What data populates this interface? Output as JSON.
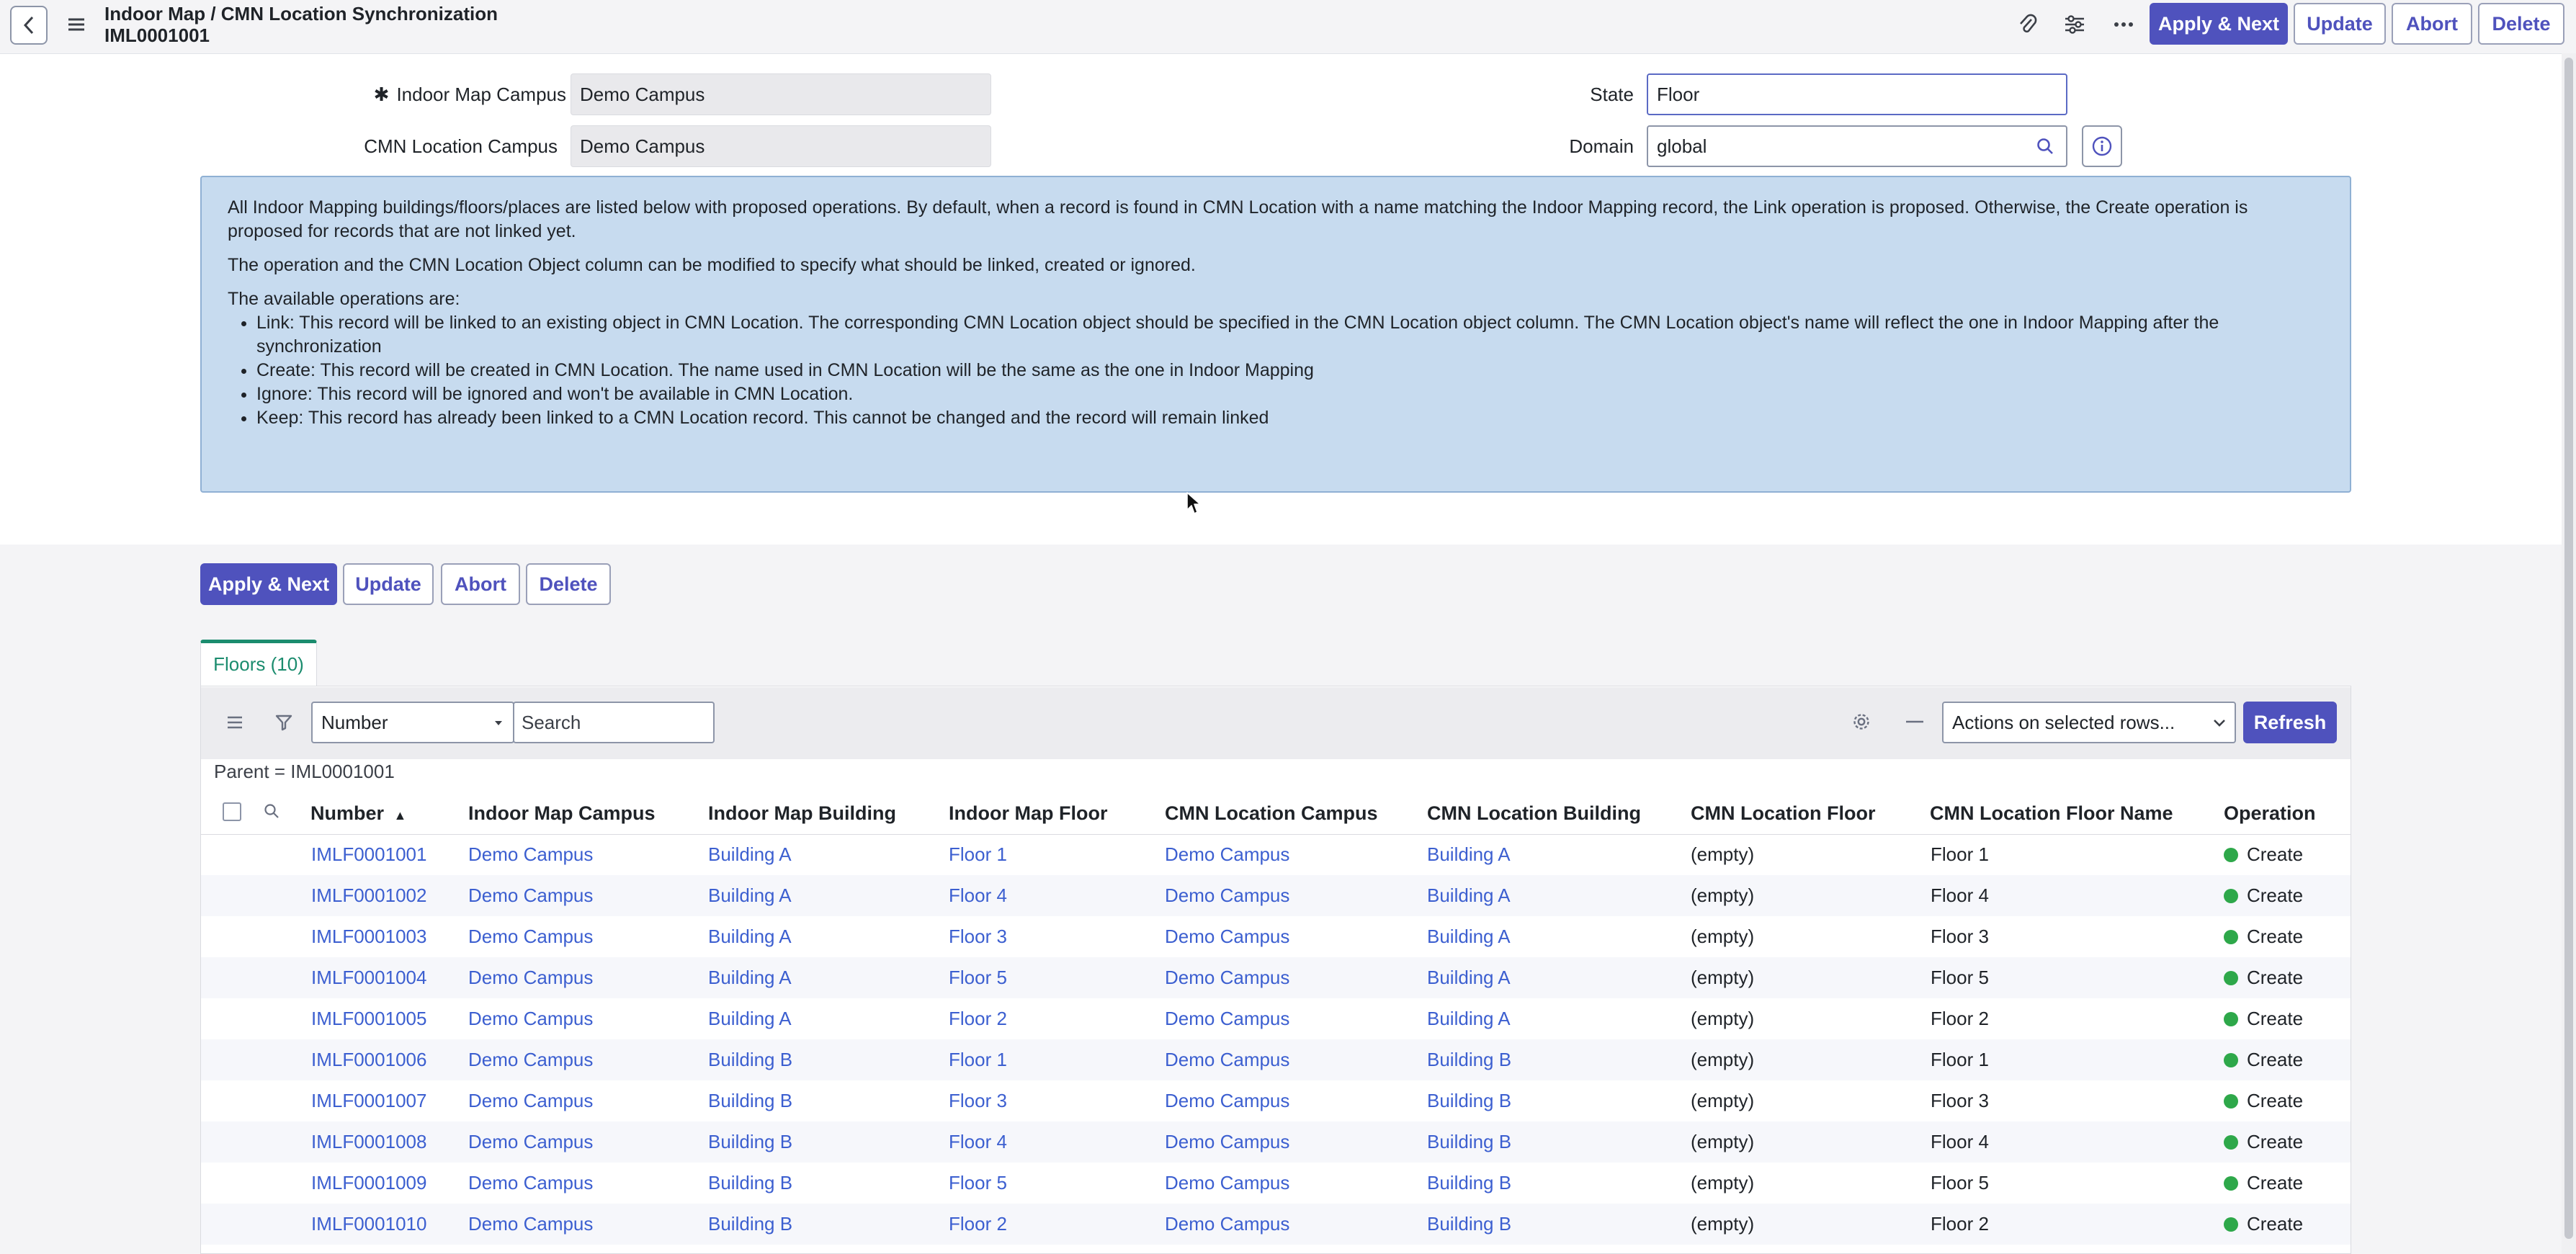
{
  "header": {
    "title": "Indoor Map / CMN Location Synchronization",
    "record_number": "IML0001001",
    "buttons": {
      "apply_next": "Apply & Next",
      "update": "Update",
      "abort": "Abort",
      "delete": "Delete"
    }
  },
  "form": {
    "indoor_map_campus_label": "Indoor Map Campus",
    "indoor_map_campus_value": "Demo Campus",
    "cmn_location_campus_label": "CMN Location Campus",
    "cmn_location_campus_value": "Demo Campus",
    "state_label": "State",
    "state_value": "Floor",
    "domain_label": "Domain",
    "domain_value": "global",
    "required_mark": "✱"
  },
  "info": {
    "p1": "All Indoor Mapping buildings/floors/places are listed below with proposed operations. By default, when a record is found in CMN Location with a name matching the Indoor Mapping record, the Link operation is proposed. Otherwise, the Create operation is proposed for records that are not linked yet.",
    "p2": "The operation and the CMN Location Object column can be modified to specify what should be linked, created or ignored.",
    "p3": "The available operations are:",
    "items": [
      "Link: This record will be linked to an existing object in CMN Location. The corresponding CMN Location object should be specified in the CMN Location object column. The CMN Location object's name will reflect the one in Indoor Mapping after the synchronization",
      "Create: This record will be created in CMN Location. The name used in CMN Location will be the same as the one in Indoor Mapping",
      "Ignore: This record will be ignored and won't be available in CMN Location.",
      "Keep: This record has already been linked to a CMN Location record. This cannot be changed and the record will remain linked"
    ]
  },
  "bottom_buttons": {
    "apply_next": "Apply & Next",
    "update": "Update",
    "abort": "Abort",
    "delete": "Delete"
  },
  "list": {
    "tab_label": "Floors (10)",
    "search_field_select": "Number",
    "search_placeholder": "Search",
    "actions_select": "Actions on selected rows...",
    "refresh_label": "Refresh",
    "filter_breadcrumb": "Parent = IML0001001",
    "columns": [
      "Number",
      "Indoor Map Campus",
      "Indoor Map Building",
      "Indoor Map Floor",
      "CMN Location Campus",
      "CMN Location Building",
      "CMN Location Floor",
      "CMN Location Floor Name",
      "Operation"
    ],
    "sort_indicator": "▲",
    "rows": [
      {
        "number": "IMLF0001001",
        "im_campus": "Demo Campus",
        "im_building": "Building A",
        "im_floor": "Floor 1",
        "cmn_campus": "Demo Campus",
        "cmn_building": "Building A",
        "cmn_floor": "(empty)",
        "cmn_floor_name": "Floor 1",
        "operation": "Create"
      },
      {
        "number": "IMLF0001002",
        "im_campus": "Demo Campus",
        "im_building": "Building A",
        "im_floor": "Floor 4",
        "cmn_campus": "Demo Campus",
        "cmn_building": "Building A",
        "cmn_floor": "(empty)",
        "cmn_floor_name": "Floor 4",
        "operation": "Create"
      },
      {
        "number": "IMLF0001003",
        "im_campus": "Demo Campus",
        "im_building": "Building A",
        "im_floor": "Floor 3",
        "cmn_campus": "Demo Campus",
        "cmn_building": "Building A",
        "cmn_floor": "(empty)",
        "cmn_floor_name": "Floor 3",
        "operation": "Create"
      },
      {
        "number": "IMLF0001004",
        "im_campus": "Demo Campus",
        "im_building": "Building A",
        "im_floor": "Floor 5",
        "cmn_campus": "Demo Campus",
        "cmn_building": "Building A",
        "cmn_floor": "(empty)",
        "cmn_floor_name": "Floor 5",
        "operation": "Create"
      },
      {
        "number": "IMLF0001005",
        "im_campus": "Demo Campus",
        "im_building": "Building A",
        "im_floor": "Floor 2",
        "cmn_campus": "Demo Campus",
        "cmn_building": "Building A",
        "cmn_floor": "(empty)",
        "cmn_floor_name": "Floor 2",
        "operation": "Create"
      },
      {
        "number": "IMLF0001006",
        "im_campus": "Demo Campus",
        "im_building": "Building B",
        "im_floor": "Floor 1",
        "cmn_campus": "Demo Campus",
        "cmn_building": "Building B",
        "cmn_floor": "(empty)",
        "cmn_floor_name": "Floor 1",
        "operation": "Create"
      },
      {
        "number": "IMLF0001007",
        "im_campus": "Demo Campus",
        "im_building": "Building B",
        "im_floor": "Floor 3",
        "cmn_campus": "Demo Campus",
        "cmn_building": "Building B",
        "cmn_floor": "(empty)",
        "cmn_floor_name": "Floor 3",
        "operation": "Create"
      },
      {
        "number": "IMLF0001008",
        "im_campus": "Demo Campus",
        "im_building": "Building B",
        "im_floor": "Floor 4",
        "cmn_campus": "Demo Campus",
        "cmn_building": "Building B",
        "cmn_floor": "(empty)",
        "cmn_floor_name": "Floor 4",
        "operation": "Create"
      },
      {
        "number": "IMLF0001009",
        "im_campus": "Demo Campus",
        "im_building": "Building B",
        "im_floor": "Floor 5",
        "cmn_campus": "Demo Campus",
        "cmn_building": "Building B",
        "cmn_floor": "(empty)",
        "cmn_floor_name": "Floor 5",
        "operation": "Create"
      },
      {
        "number": "IMLF0001010",
        "im_campus": "Demo Campus",
        "im_building": "Building B",
        "im_floor": "Floor 2",
        "cmn_campus": "Demo Campus",
        "cmn_building": "Building B",
        "cmn_floor": "(empty)",
        "cmn_floor_name": "Floor 2",
        "operation": "Create"
      }
    ]
  },
  "colors": {
    "primary": "#4f52bd",
    "link": "#3c5fd0",
    "tab_accent": "#1b8c6e",
    "info_bg": "#c7dbef",
    "create_status": "#2ea84a"
  },
  "icons": [
    "chevron-left-icon",
    "hamburger-icon",
    "paperclip-icon",
    "sliders-icon",
    "more-icon",
    "search-icon",
    "info-icon",
    "filter-icon",
    "gear-icon",
    "minus-icon",
    "caret-down-icon",
    "mouse-cursor-icon"
  ]
}
